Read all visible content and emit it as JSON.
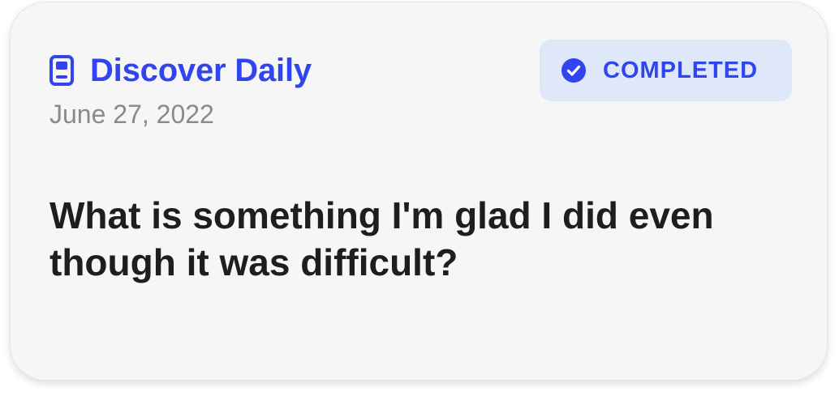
{
  "card": {
    "title": "Discover Daily",
    "title_icon": "book-icon",
    "date": "June 27, 2022",
    "status": {
      "label": "COMPLETED",
      "icon": "check-circle-icon",
      "color": "#3045ee",
      "background": "#dfe8f8"
    },
    "prompt": "What is something I'm glad I did even though it was difficult?"
  }
}
